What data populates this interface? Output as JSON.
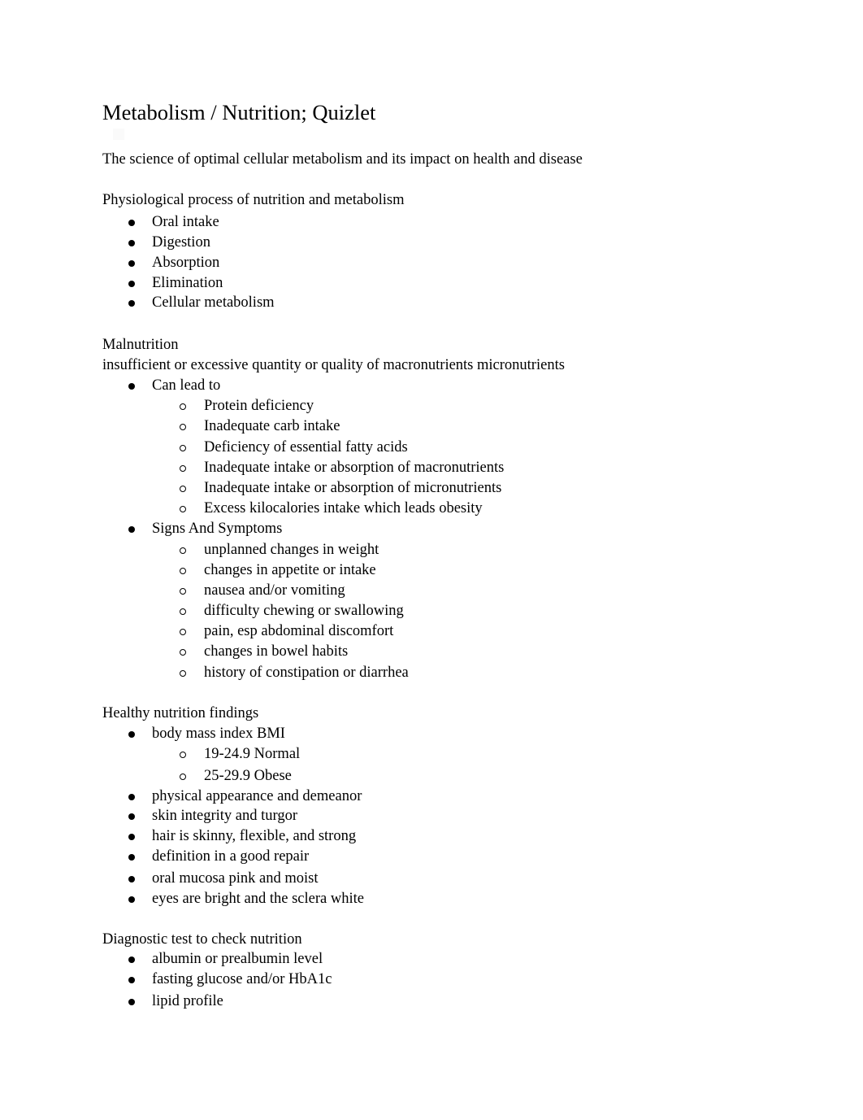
{
  "document": {
    "title": "Metabolism / Nutrition; Quizlet",
    "intro": "The science of optimal cellular metabolism and its impact on health and disease",
    "section1": {
      "heading": "Physiological process of nutrition and metabolism",
      "items": [
        "Oral intake",
        "Digestion",
        "Absorption",
        "Elimination",
        "Cellular metabolism"
      ]
    },
    "section2": {
      "heading": "Malnutrition",
      "definition": "insufficient or excessive quantity or quality of macronutrients micronutrients",
      "groups": [
        {
          "label": "Can lead to",
          "items": [
            "Protein deficiency",
            "Inadequate carb intake",
            "Deficiency of essential fatty acids",
            "Inadequate intake or absorption of macronutrients",
            "Inadequate intake or absorption of micronutrients",
            "Excess kilocalories intake which leads obesity"
          ]
        },
        {
          "label": "Signs And Symptoms",
          "items": [
            "unplanned changes in weight",
            "changes in appetite or intake",
            "nausea and/or vomiting",
            "difficulty chewing or swallowing",
            "pain, esp abdominal discomfort",
            "changes in bowel habits",
            "history of constipation or diarrhea"
          ]
        }
      ]
    },
    "section3": {
      "heading": "Healthy nutrition findings",
      "bmi": {
        "label": "body mass index BMI",
        "items": [
          "19-24.9 Normal",
          "25-29.9 Obese"
        ]
      },
      "items": [
        "physical appearance and demeanor",
        "skin integrity and turgor",
        "hair is skinny, flexible, and strong",
        "definition in a good repair",
        "oral mucosa pink and moist",
        "eyes are bright and the sclera white"
      ]
    },
    "section4": {
      "heading": "Diagnostic test to check nutrition",
      "items": [
        "albumin or prealbumin level",
        "fasting glucose and/or HbA1c",
        "lipid profile"
      ]
    }
  }
}
